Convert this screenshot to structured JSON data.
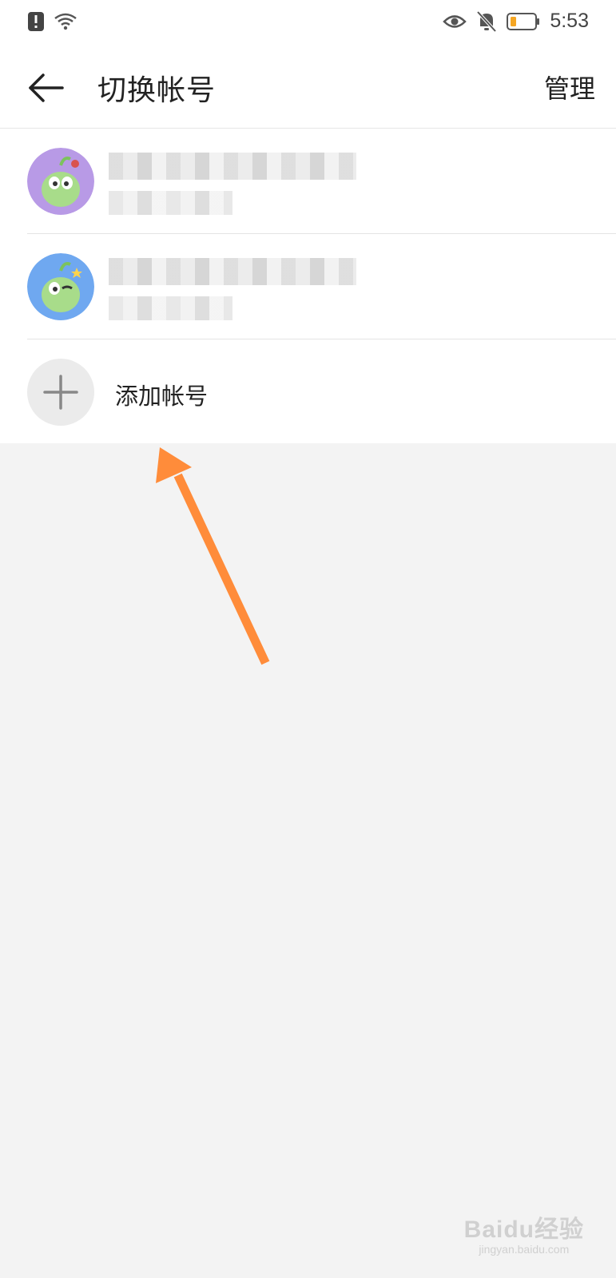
{
  "status_bar": {
    "time": "5:53",
    "icons": [
      "alert-icon",
      "wifi-icon",
      "eye-icon",
      "bell-off-icon",
      "battery-icon"
    ]
  },
  "header": {
    "title": "切换帐号",
    "manage_label": "管理",
    "back_icon": "back-arrow-icon"
  },
  "accounts": [
    {
      "avatar_color": "#b89ae6",
      "name": "",
      "detail": ""
    },
    {
      "avatar_color": "#6fa8f0",
      "name": "",
      "detail": ""
    }
  ],
  "add_account": {
    "label": "添加帐号",
    "icon": "plus-icon"
  },
  "annotation": {
    "arrow_color": "#ff8c3a"
  },
  "watermark": {
    "brand": "Baidu经验",
    "site": "jingyan.baidu.com"
  }
}
